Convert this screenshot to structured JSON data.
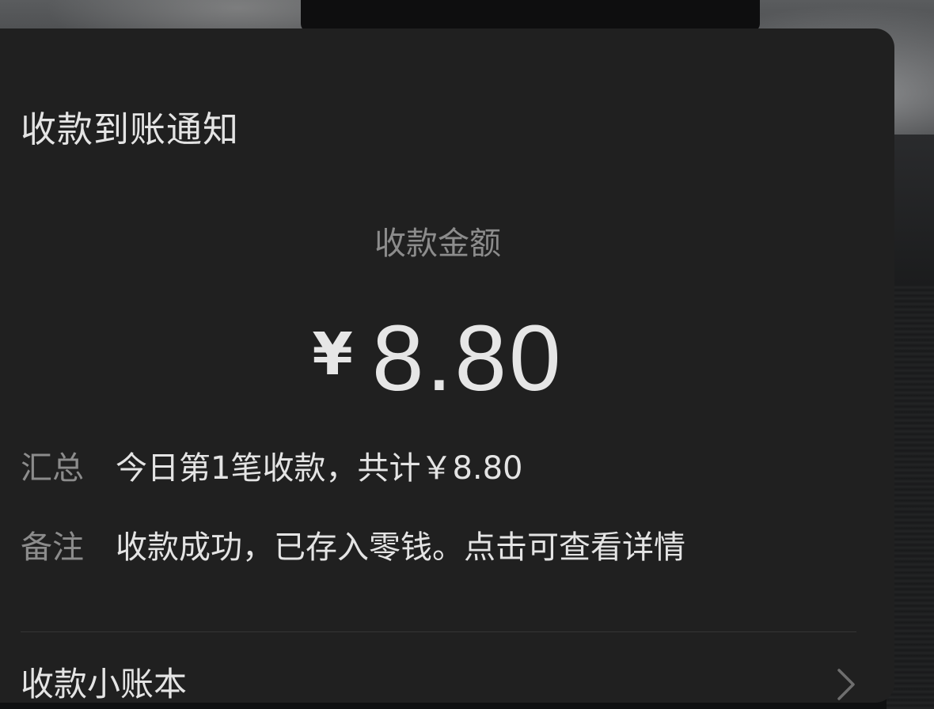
{
  "notification": {
    "title": "收款到账通知",
    "amount_label": "收款金额",
    "currency_symbol": "¥",
    "amount": "8.80",
    "summary": {
      "label": "汇总",
      "value": "今日第1笔收款，共计￥8.80"
    },
    "note": {
      "label": "备注",
      "value": "收款成功，已存入零钱。点击可查看详情"
    },
    "footer_link": {
      "label": "收款小账本",
      "icon": "chevron-right-icon"
    }
  },
  "colors": {
    "card_background": "#202020",
    "primary_text": "#e4e4e4",
    "secondary_text": "#8c8c8c",
    "divider": "#353535"
  }
}
